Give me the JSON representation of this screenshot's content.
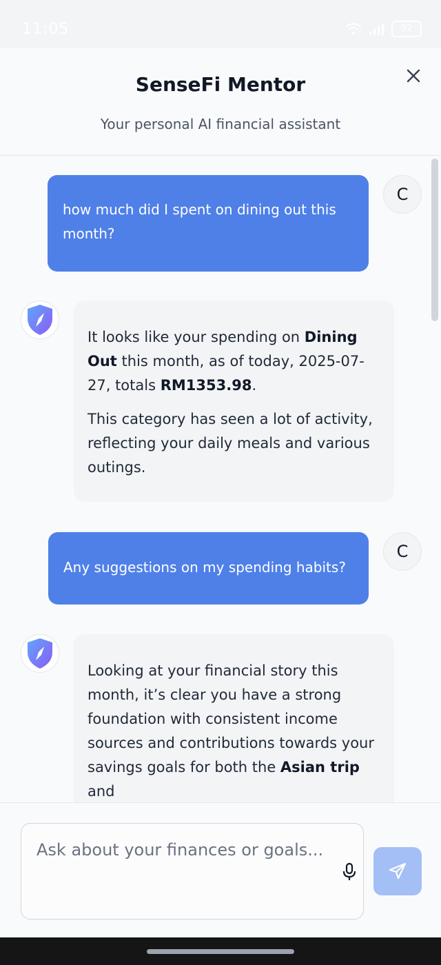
{
  "status_bar": {
    "time": "11:05",
    "battery": "92"
  },
  "header": {
    "title": "SenseFi Mentor",
    "subtitle": "Your personal AI financial assistant",
    "close_icon": "close-icon"
  },
  "messages": [
    {
      "role": "user",
      "avatar_initial": "C",
      "text": "how much did I spent on dining out this month?"
    },
    {
      "role": "assistant",
      "avatar_icon": "shield-compass-icon",
      "paragraphs": [
        {
          "parts": [
            {
              "text": "It looks like your spending on ",
              "bold": false
            },
            {
              "text": "Dining Out",
              "bold": true
            },
            {
              "text": " this month, as of today, 2025-07-27, totals ",
              "bold": false
            },
            {
              "text": "RM1353.98",
              "bold": true
            },
            {
              "text": ".",
              "bold": false
            }
          ]
        },
        {
          "parts": [
            {
              "text": "This category has seen a lot of activity, reflecting your daily meals and various outings.",
              "bold": false
            }
          ]
        }
      ]
    },
    {
      "role": "user",
      "avatar_initial": "C",
      "text": "Any suggestions on my spending habits?"
    },
    {
      "role": "assistant",
      "avatar_icon": "shield-compass-icon",
      "paragraphs": [
        {
          "parts": [
            {
              "text": "Looking at your financial story this month, it’s clear you have a strong foundation with consistent income sources and contributions towards your savings goals for both the ",
              "bold": false
            },
            {
              "text": "Asian trip",
              "bold": true
            },
            {
              "text": " and",
              "bold": false
            }
          ]
        }
      ]
    }
  ],
  "composer": {
    "placeholder": "Ask about your finances or goals...",
    "mic_icon": "microphone-icon",
    "send_icon": "send-icon"
  },
  "colors": {
    "user_bubble": "#4f80e8",
    "bot_bubble": "#f3f4f6",
    "send_button": "#a3bff5",
    "background": "#f9fafb"
  }
}
